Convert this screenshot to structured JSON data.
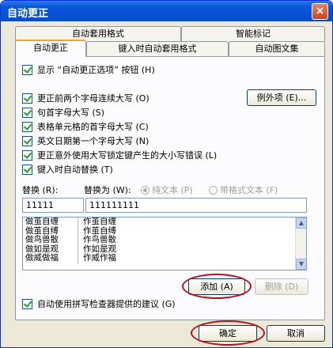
{
  "window": {
    "title": "自动更正",
    "close_glyph": "×"
  },
  "tabs_back": [
    {
      "name": "tab-autoformat",
      "label": "自动套用格式"
    },
    {
      "name": "tab-smart-tags",
      "label": "智能标记"
    }
  ],
  "tabs_front": [
    {
      "name": "tab-autocorrect",
      "label": "自动更正"
    },
    {
      "name": "tab-autoformat-as-you-type",
      "label": "键入时自动套用格式"
    },
    {
      "name": "tab-autotext",
      "label": "自动图文集"
    }
  ],
  "options": {
    "show_buttons": "显示 “自动更正选项” 按钮 (H)",
    "two_initial_caps": "更正前两个字母连续大写 (O)",
    "capitalize_sentences": "句首字母大写 (S)",
    "capitalize_table_cells": "表格单元格的首字母大写 (C)",
    "capitalize_days": "英文日期第一个字母大写 (N)",
    "caps_lock": "更正意外使用大写锁定键产生的大小写错误 (L)",
    "replace_as_you_type": "键入时自动替换 (T)",
    "use_spellchecker": "自动使用拼写检查器提供的建议 (G)"
  },
  "buttons": {
    "exceptions": "例外项 (E)...",
    "add": "添加 (A)",
    "delete": "删除 (D)",
    "ok": "确定",
    "cancel": "取消"
  },
  "replace": {
    "replace_label": "替换 (R):",
    "with_label": "替换为 (W):",
    "plain_text": "纯文本 (P)",
    "formatted_text": "带格式文本 (F)",
    "replace_value": "11111",
    "with_value": "111111111"
  },
  "entries": [
    {
      "from": "做茧自缠",
      "to": "作茧自缠"
    },
    {
      "from": "做茧自缚",
      "to": "作茧自缚"
    },
    {
      "from": "做鸟兽散",
      "to": "作鸟兽散"
    },
    {
      "from": "做如是观",
      "to": "作如是观"
    },
    {
      "from": "做威做福",
      "to": "作威作福"
    }
  ],
  "colors": {
    "highlight_circle": "#b3121e",
    "title_bar": "#0650d6"
  }
}
